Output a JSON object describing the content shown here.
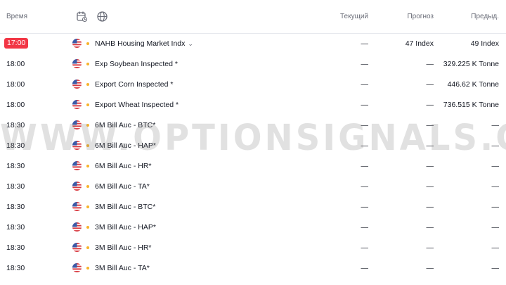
{
  "header": {
    "time_label": "Время",
    "current_label": "Текущий",
    "forecast_label": "Прогноз",
    "previous_label": "Предыд."
  },
  "rows": [
    {
      "time": "17:00",
      "live": true,
      "event": "NAHB Housing Market Indx",
      "has_chevron": true,
      "current": "—",
      "forecast": "47 Index",
      "previous": "49 Index"
    },
    {
      "time": "18:00",
      "event": "Exp Soybean Inspected *",
      "current": "—",
      "forecast": "—",
      "previous": "329.225 K Tonne"
    },
    {
      "time": "18:00",
      "event": "Export Corn Inspected *",
      "current": "—",
      "forecast": "—",
      "previous": "446.62 K Tonne"
    },
    {
      "time": "18:00",
      "event": "Export Wheat Inspected *",
      "current": "—",
      "forecast": "—",
      "previous": "736.515 K Tonne"
    },
    {
      "time": "18:30",
      "event": "6M Bill Auc - BTC*",
      "current": "—",
      "forecast": "—",
      "previous": "—"
    },
    {
      "time": "18:30",
      "event": "6M Bill Auc - HAP*",
      "current": "—",
      "forecast": "—",
      "previous": "—"
    },
    {
      "time": "18:30",
      "event": "6M Bill Auc - HR*",
      "current": "—",
      "forecast": "—",
      "previous": "—"
    },
    {
      "time": "18:30",
      "event": "6M Bill Auc - TA*",
      "current": "—",
      "forecast": "—",
      "previous": "—"
    },
    {
      "time": "18:30",
      "event": "3M Bill Auc - BTC*",
      "current": "—",
      "forecast": "—",
      "previous": "—"
    },
    {
      "time": "18:30",
      "event": "3M Bill Auc - HAP*",
      "current": "—",
      "forecast": "—",
      "previous": "—"
    },
    {
      "time": "18:30",
      "event": "3M Bill Auc - HR*",
      "current": "—",
      "forecast": "—",
      "previous": "—"
    },
    {
      "time": "18:30",
      "event": "3M Bill Auc - TA*",
      "current": "—",
      "forecast": "—",
      "previous": "—"
    }
  ],
  "watermark": "WWW.OPTIONSIGNALS.COM",
  "colors": {
    "live_time_bg": "#f23645",
    "importance_dot": "#f7b32b",
    "header_text": "#6a6d78"
  },
  "icons": {
    "calendar_filter": "calendar-icon",
    "country_filter": "globe-icon",
    "country_flag": "us-flag-icon"
  }
}
